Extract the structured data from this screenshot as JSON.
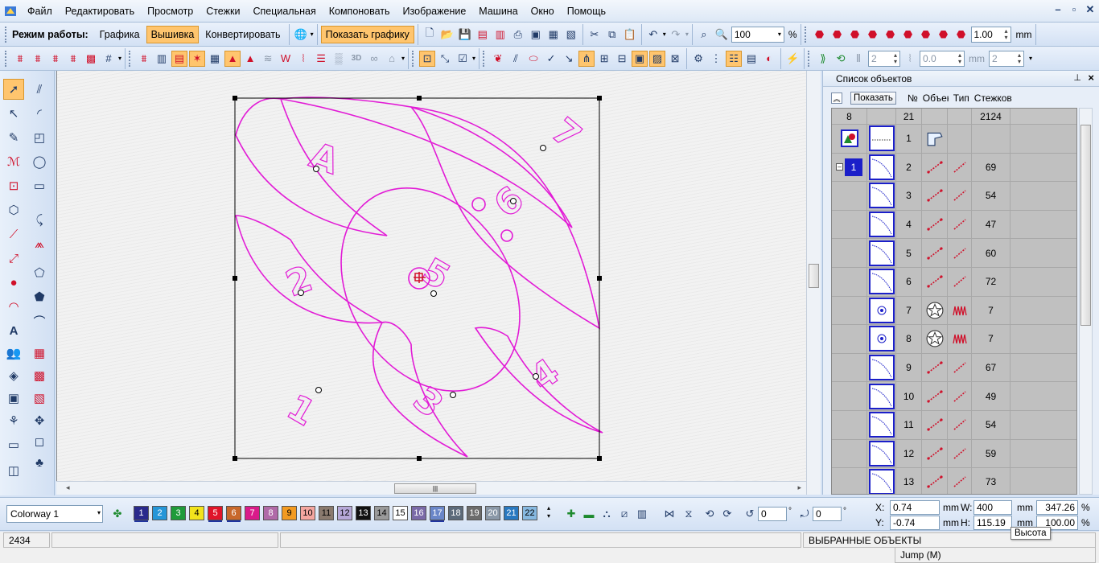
{
  "menu": [
    "Файл",
    "Редактировать",
    "Просмотр",
    "Стежки",
    "Специальная",
    "Компоновать",
    "Изображение",
    "Машина",
    "Окно",
    "Помощь"
  ],
  "window_controls": [
    "–",
    "▫",
    "✕"
  ],
  "mode_bar": {
    "label": "Режим работы:",
    "buttons": [
      "Графика",
      "Вышивка",
      "Конвертировать"
    ],
    "active": "Вышивка",
    "show_graphics": "Показать графику"
  },
  "zoom": {
    "value": "100",
    "unit": "%"
  },
  "thread_width": {
    "value": "1.00",
    "unit": "mm"
  },
  "toolbar2_inputs": {
    "count1": "2",
    "gap": "0.0",
    "gap_unit": "mm",
    "count2": "2"
  },
  "panel": {
    "title": "Список объектов",
    "show_button": "Показать",
    "columns": [
      "№",
      "Объект",
      "Тип",
      "Стежков"
    ],
    "summary": {
      "groups": "8",
      "objects": "21",
      "stitches": "2124"
    },
    "group_label": "1",
    "rows": [
      {
        "num": "1",
        "kind": "shape",
        "stitches": ""
      },
      {
        "num": "2",
        "kind": "run",
        "stitches": "69"
      },
      {
        "num": "3",
        "kind": "run",
        "stitches": "54"
      },
      {
        "num": "4",
        "kind": "run",
        "stitches": "47"
      },
      {
        "num": "5",
        "kind": "run",
        "stitches": "60"
      },
      {
        "num": "6",
        "kind": "run",
        "stitches": "72"
      },
      {
        "num": "7",
        "kind": "star",
        "stitches": "7"
      },
      {
        "num": "8",
        "kind": "star",
        "stitches": "7"
      },
      {
        "num": "9",
        "kind": "run",
        "stitches": "67"
      },
      {
        "num": "10",
        "kind": "run",
        "stitches": "49"
      },
      {
        "num": "11",
        "kind": "run",
        "stitches": "54"
      },
      {
        "num": "12",
        "kind": "run",
        "stitches": "59"
      },
      {
        "num": "13",
        "kind": "run",
        "stitches": "73"
      }
    ]
  },
  "colorway": "Colorway 1",
  "palette": [
    {
      "n": "1",
      "color": "#2a2a8c",
      "text": "#ffffff",
      "ul": true
    },
    {
      "n": "2",
      "color": "#2596d8",
      "text": "#ffffff",
      "ul": false
    },
    {
      "n": "3",
      "color": "#1f9b3a",
      "text": "#ffffff",
      "ul": false
    },
    {
      "n": "4",
      "color": "#f2e31c",
      "text": "#000000",
      "ul": false
    },
    {
      "n": "5",
      "color": "#e0142a",
      "text": "#ffffff",
      "ul": true
    },
    {
      "n": "6",
      "color": "#c8682c",
      "text": "#ffffff",
      "ul": true
    },
    {
      "n": "7",
      "color": "#d91a8a",
      "text": "#ffffff",
      "ul": false
    },
    {
      "n": "8",
      "color": "#b06aa8",
      "text": "#ffffff",
      "ul": false
    },
    {
      "n": "9",
      "color": "#f29a22",
      "text": "#000000",
      "ul": false
    },
    {
      "n": "10",
      "color": "#f4a6a0",
      "text": "#000000",
      "ul": false
    },
    {
      "n": "11",
      "color": "#8a7a6e",
      "text": "#000000",
      "ul": false
    },
    {
      "n": "12",
      "color": "#b6a8d8",
      "text": "#000000",
      "ul": false
    },
    {
      "n": "13",
      "color": "#111111",
      "text": "#ffffff",
      "ul": false
    },
    {
      "n": "14",
      "color": "#9a9a9a",
      "text": "#000000",
      "ul": false
    },
    {
      "n": "15",
      "color": "#ffffff",
      "text": "#000000",
      "ul": false
    },
    {
      "n": "16",
      "color": "#7a6aa8",
      "text": "#ffffff",
      "ul": false
    },
    {
      "n": "17",
      "color": "#6a86c8",
      "text": "#ffffff",
      "ul": true
    },
    {
      "n": "18",
      "color": "#5c6a7a",
      "text": "#ffffff",
      "ul": false
    },
    {
      "n": "19",
      "color": "#6c6c6c",
      "text": "#ffffff",
      "ul": false
    },
    {
      "n": "20",
      "color": "#8a98a8",
      "text": "#ffffff",
      "ul": false
    },
    {
      "n": "21",
      "color": "#2878c0",
      "text": "#ffffff",
      "ul": false
    },
    {
      "n": "22",
      "color": "#86b8e0",
      "text": "#000000",
      "ul": false
    }
  ],
  "rotate_value": "0",
  "slant_value": "0",
  "coords": {
    "x_label": "X:",
    "x": "0.74",
    "y_label": "Y:",
    "y": "-0.74",
    "unit": "mm",
    "w_label": "W:",
    "w": "400",
    "w_pct": "347.26",
    "h_label": "H:",
    "h": "115.19",
    "h_pct": "100.00",
    "pct": "%"
  },
  "tooltip": "Высота",
  "status": {
    "stitch_count": "2434",
    "selection": "ВЫБРАННЫЕ ОБЪЕКТЫ",
    "command": "Jump (M)"
  },
  "design_digits": [
    "1",
    "2",
    "3",
    "4",
    "4",
    "5",
    "6",
    "7",
    "A"
  ],
  "colors": {
    "accent": "#ffc56e",
    "stitch": "#e21bd6",
    "selection_blue": "#1b1fc9"
  }
}
